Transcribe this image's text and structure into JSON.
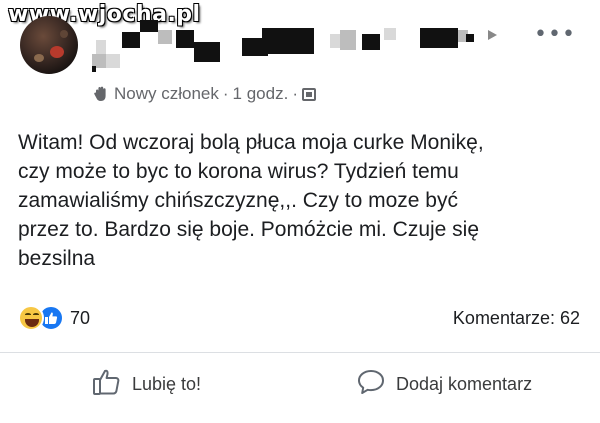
{
  "watermark": "www.wjocha.pl",
  "author": {
    "badge": "Nowy członek",
    "time": "1 godz."
  },
  "post": {
    "lines": [
      "Witam! Od wczoraj bolą płuca moja curke Monikę,",
      "czy może to byc to korona wirus? Tydzień temu",
      "zamawialiśmy chińszczyznę,,. Czy to moze być",
      "przez to. Bardzo się boje. Pomóżcie mi. Czuje się",
      "bezsilna"
    ]
  },
  "reactions": {
    "count": "70",
    "icons": [
      "haha-icon",
      "like-icon"
    ]
  },
  "comments": {
    "label": "Komentarze: 62"
  },
  "actions": {
    "like_label": "Lubię to!",
    "comment_label": "Dodaj komentarz"
  },
  "colors": {
    "like_blue": "#1877f2",
    "haha_yellow": "#f7c744",
    "meta_gray": "#65676b"
  }
}
